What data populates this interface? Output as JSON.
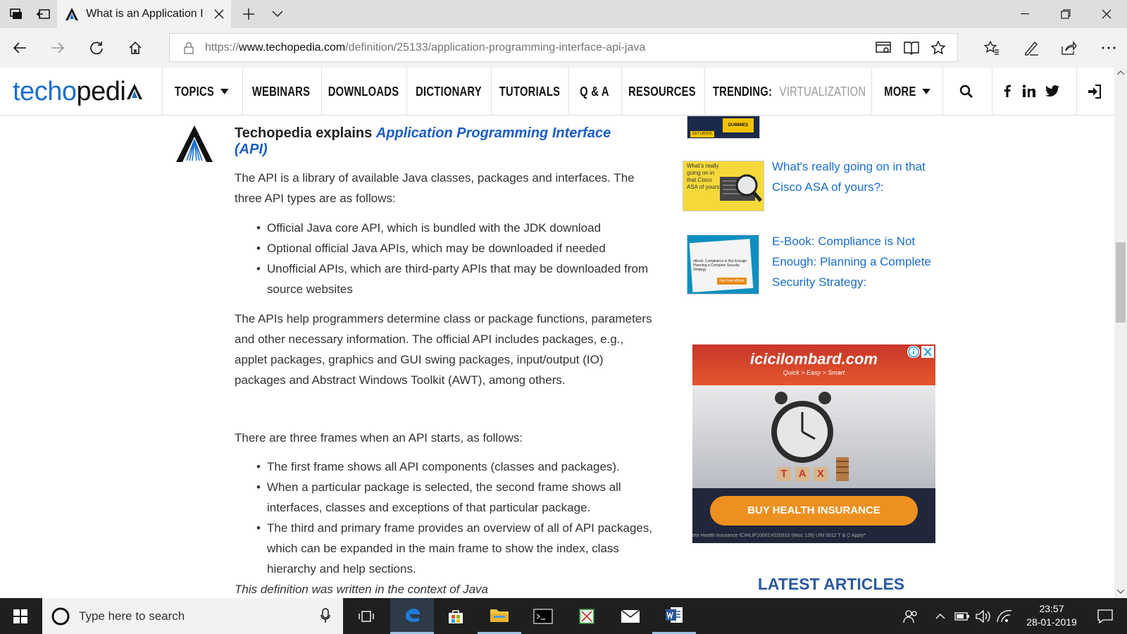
{
  "browser": {
    "tab_title": "What is an Application I",
    "url_prefix": "https://",
    "url_domain": "www.techopedia.com",
    "url_path": "/definition/25133/application-programming-interface-api-java"
  },
  "site": {
    "logo_text_a": "techo",
    "logo_text_b": "pedi",
    "logo_color": "#1a6ed0",
    "nav": [
      "TOPICS",
      "WEBINARS",
      "DOWNLOADS",
      "DICTIONARY",
      "TUTORIALS",
      "Q & A",
      "RESOURCES",
      "TRENDING:",
      "VIRTUALIZATION",
      "MORE"
    ]
  },
  "article": {
    "heading_prefix": "Techopedia explains ",
    "heading_link": "Application Programming Interface (API)",
    "p1": "The API is a library of available Java classes, packages and interfaces. The three API types are as follows:",
    "bullets1": [
      "Official Java core API, which is bundled with the JDK download",
      "Optional official Java APIs, which may be downloaded if needed",
      "Unofficial APIs, which are third-party APIs that may be downloaded from source websites"
    ],
    "p2": "The APIs help programmers determine class or package functions, parameters and other necessary information. The official API includes packages, e.g., applet packages, graphics and GUI swing packages, input/output (IO) packages and Abstract Windows Toolkit (AWT), among others.",
    "p3": "There are three frames when an API starts, as follows:",
    "bullets2": [
      "The first frame shows all API components (classes and packages).",
      "When a particular package is selected, the second frame shows all interfaces, classes and exceptions of that particular package.",
      "The third and primary frame provides an overview of all of API packages, which can be expanded in the main frame to show the index, class hierarchy and help sections."
    ],
    "footer_partial": "This definition was written in the context of Java"
  },
  "sidebar": {
    "link1": "What's really going on in that Cisco ASA of yours?:",
    "link2": "E-Book: Compliance is Not Enough: Planning a Complete Security Strategy:",
    "thumb1_text": "What's really going on in that Cisco ASA of yours?",
    "thumb2_text": "eBook: Compliance is Not Enough Planning a Complete Security Strategy",
    "thumb2_cta": "Get Free eBook",
    "thumb0_cta": "GET eBOOK",
    "thumb0_brand": "DUMMIES",
    "ad_brand": "icicilombard.com",
    "ad_tagline": "Quick  >  Easy  >  Smart",
    "ad_tax": [
      "T",
      "A",
      "X"
    ],
    "ad_cta": "BUY HEALTH INSURANCE",
    "ad_fine": "ete Health Insurance ICIHLIP10001V020910 (Misc 128) UIN 5512 T & C Apply*",
    "latest": "LATEST ARTICLES"
  },
  "taskbar": {
    "search_placeholder": "Type here to search",
    "time": "23:57",
    "date": "28-01-2019"
  }
}
